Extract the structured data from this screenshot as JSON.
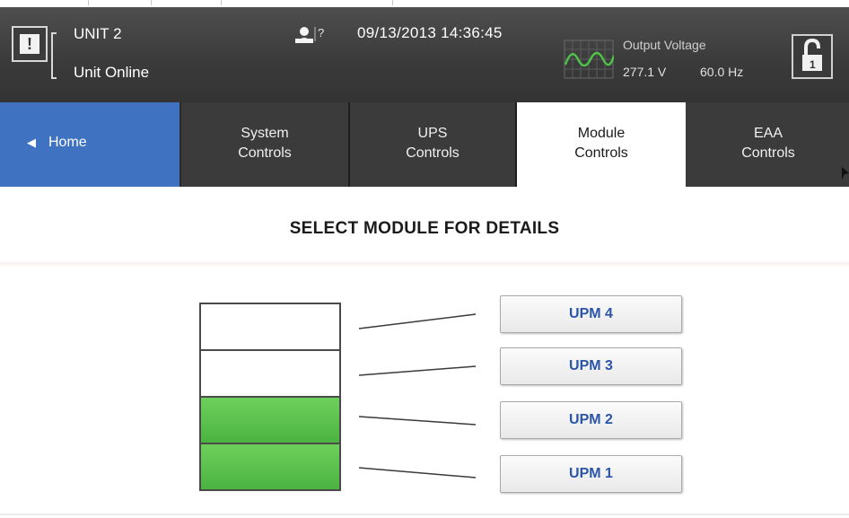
{
  "header": {
    "unit_name": "UNIT 2",
    "unit_status": "Unit Online",
    "datetime": "09/13/2013 14:36:45",
    "user_icon_glyph": "?",
    "output_voltage": {
      "title": "Output Voltage",
      "voltage": "277.1 V",
      "frequency": "60.0 Hz"
    },
    "icons": [
      "alarm-icon",
      "user-help-icon",
      "waveform-icon",
      "lock-icon"
    ]
  },
  "nav": {
    "home": "Home",
    "tabs": [
      {
        "line1": "System",
        "line2": "Controls"
      },
      {
        "line1": "UPS",
        "line2": "Controls"
      },
      {
        "line1": "Module",
        "line2": "Controls",
        "active": true
      },
      {
        "line1": "EAA",
        "line2": "Controls"
      }
    ]
  },
  "main": {
    "title": "SELECT MODULE FOR DETAILS",
    "modules": [
      {
        "label": "UPM 4",
        "online": false
      },
      {
        "label": "UPM 3",
        "online": false
      },
      {
        "label": "UPM 2",
        "online": true
      },
      {
        "label": "UPM 1",
        "online": true
      }
    ]
  },
  "colors": {
    "header_bg": "#3a3a3a",
    "home_tab": "#3f72c1",
    "module_online": "#5cc24f",
    "upm_text": "#2a55a8"
  }
}
